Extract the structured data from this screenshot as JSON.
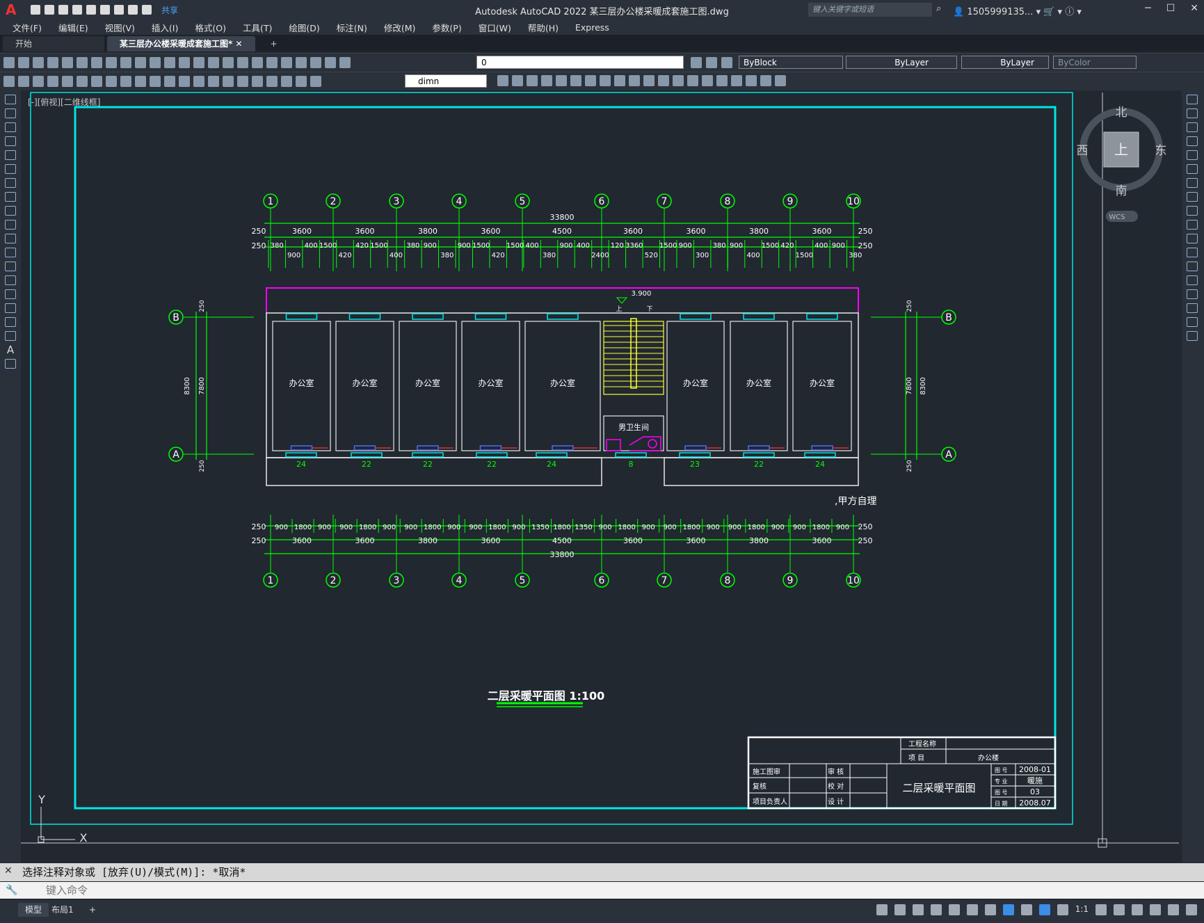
{
  "app": {
    "title": "Autodesk AutoCAD 2022    某三层办公楼采暖成套施工图.dwg",
    "search_placeholder": "键入关键字或短语",
    "user": "1505999135...",
    "share": "共享"
  },
  "menu": [
    "文件(F)",
    "编辑(E)",
    "视图(V)",
    "插入(I)",
    "格式(O)",
    "工具(T)",
    "绘图(D)",
    "标注(N)",
    "修改(M)",
    "参数(P)",
    "窗口(W)",
    "帮助(H)",
    "Express"
  ],
  "tabs": [
    "开始",
    "某三层办公楼采暖成套施工图*"
  ],
  "toolbar": {
    "layer_combo": "0",
    "color_combo": "ByBlock",
    "linetype_combo": "ByLayer",
    "lineweight_combo": "ByLayer",
    "plotstyle_combo": "ByColor",
    "dimstyle_combo": "dimn"
  },
  "viewport_label": "[-][俯视][二维线框]",
  "viewcube": {
    "north": "北",
    "south": "南",
    "east": "东",
    "west": "西",
    "face": "上",
    "wcs": "WCS"
  },
  "drawing": {
    "axes": [
      "1",
      "2",
      "3",
      "4",
      "5",
      "6",
      "7",
      "8",
      "9",
      "10"
    ],
    "rows": [
      "A",
      "B"
    ],
    "top_total": "33800",
    "top_bays": [
      "3600",
      "3600",
      "3800",
      "3600",
      "4500",
      "3600",
      "3600",
      "3800",
      "3600"
    ],
    "edge": "250",
    "top_detail": [
      "380",
      "900",
      "400",
      "1500",
      "420",
      "420",
      "1500",
      "400",
      "380",
      "900",
      "380",
      "900",
      "1500",
      "420",
      "1500",
      "400",
      "380",
      "900",
      "400",
      "2400",
      "120",
      "3360",
      "520",
      "1500",
      "900",
      "300",
      "380",
      "900",
      "400",
      "1500",
      "420",
      "1500",
      "400",
      "900",
      "380"
    ],
    "bottom_detail": [
      "900",
      "1800",
      "900",
      "900",
      "1800",
      "900",
      "900",
      "1800",
      "900",
      "900",
      "1800",
      "900",
      "1350",
      "1800",
      "1350",
      "900",
      "1800",
      "900",
      "900",
      "1800",
      "900",
      "900",
      "1800",
      "900",
      "900",
      "1800",
      "900"
    ],
    "bottom_bays": [
      "3600",
      "3600",
      "3800",
      "3600",
      "4500",
      "3600",
      "3600",
      "3800",
      "3600"
    ],
    "bottom_total": "33800",
    "side_outer": "8300",
    "side_inner": "7800",
    "rooms": [
      "办公室",
      "办公室",
      "办公室",
      "办公室",
      "办公室",
      "办公室",
      "办公室",
      "办公室"
    ],
    "toilet": "男卫生间",
    "elevation": "3.900",
    "stair_up": "上",
    "stair_down": "下",
    "radiator_counts": [
      "24",
      "22",
      "22",
      "22",
      "24",
      "8",
      "23",
      "22",
      "24"
    ],
    "note": ",甲方自理",
    "plan_title": "二层采暖平面图 1:100"
  },
  "titleblock": {
    "project_label": "工程名称",
    "item_label": "项 目",
    "item_value": "办公楼",
    "drawing_name": "二层采暖平面图",
    "rows_left": [
      "施工图审",
      "复核",
      "项目负责人"
    ],
    "rows_mid": [
      "审 核",
      "校 对",
      "设 计"
    ],
    "codes": [
      "2008-01",
      "暖施",
      "03",
      "2008.07"
    ],
    "code_labels": [
      "图 号",
      "专 业",
      "图 号",
      "日 期"
    ]
  },
  "ucs": {
    "x": "X",
    "y": "Y"
  },
  "command": {
    "history": "选择注释对象或 [放弃(U)/模式(M)]: *取消*",
    "placeholder": "键入命令"
  },
  "status": {
    "model_tab": "模型",
    "layout_tab": "布局1",
    "scale": "1:1"
  },
  "colors": {
    "background": "#212830",
    "cyan": "#00e5e5",
    "green": "#00ff00",
    "magenta": "#ff00ff",
    "yellow": "#ffff33",
    "walls": "#e8e8e8"
  }
}
